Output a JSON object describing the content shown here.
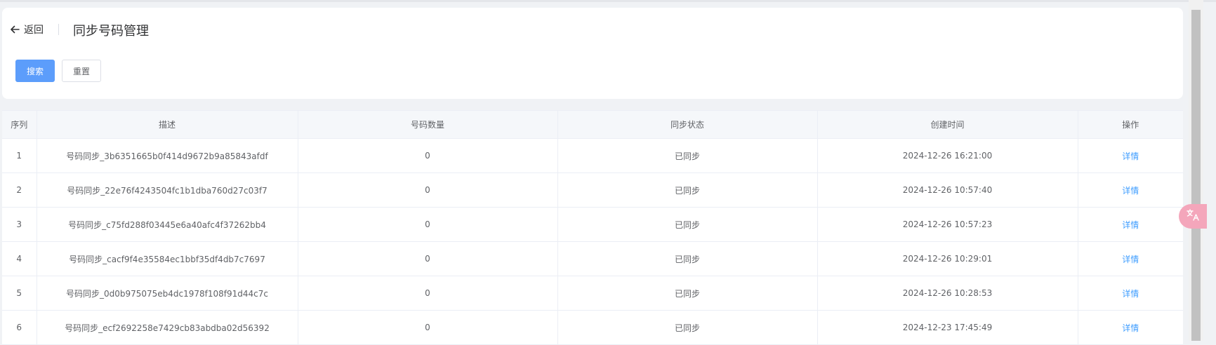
{
  "header": {
    "back_label": "返回",
    "title": "同步号码管理"
  },
  "toolbar": {
    "search_label": "搜索",
    "reset_label": "重置"
  },
  "table": {
    "columns": [
      "序列",
      "描述",
      "号码数量",
      "同步状态",
      "创建时间",
      "操作"
    ],
    "rows": [
      {
        "index": "1",
        "desc": "号码同步_3b6351665b0f414d9672b9a85843afdf",
        "count": "0",
        "status": "已同步",
        "created": "2024-12-26 16:21:00",
        "action": "详情"
      },
      {
        "index": "2",
        "desc": "号码同步_22e76f4243504fc1b1dba760d27c03f7",
        "count": "0",
        "status": "已同步",
        "created": "2024-12-26 10:57:40",
        "action": "详情"
      },
      {
        "index": "3",
        "desc": "号码同步_c75fd288f03445e6a40afc4f37262bb4",
        "count": "0",
        "status": "已同步",
        "created": "2024-12-26 10:57:23",
        "action": "详情"
      },
      {
        "index": "4",
        "desc": "号码同步_cacf9f4e35584ec1bbf35df4db7c7697",
        "count": "0",
        "status": "已同步",
        "created": "2024-12-26 10:29:01",
        "action": "详情"
      },
      {
        "index": "5",
        "desc": "号码同步_0d0b975075eb4dc1978f108f91d44c7c",
        "count": "0",
        "status": "已同步",
        "created": "2024-12-26 10:28:53",
        "action": "详情"
      },
      {
        "index": "6",
        "desc": "号码同步_ecf2692258e7429cb83abdba02d56392",
        "count": "0",
        "status": "已同步",
        "created": "2024-12-23 17:45:49",
        "action": "详情"
      }
    ]
  },
  "icons": {
    "back": "arrow-left-icon",
    "float": "translate-icon"
  },
  "colors": {
    "primary": "#5c9dfb",
    "link": "#409eff",
    "float": "#f4a6bb"
  }
}
